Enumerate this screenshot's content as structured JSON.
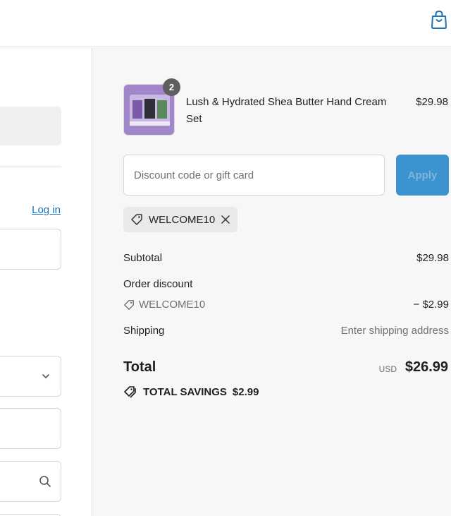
{
  "header": {
    "cart_icon": "shopping-bag-icon"
  },
  "left": {
    "login_label": "Log in"
  },
  "product": {
    "name": "Lush & Hydrated Shea Butter Hand Cream Set",
    "price": "$29.98",
    "quantity": "2"
  },
  "discount": {
    "placeholder": "Discount code or gift card",
    "apply_label": "Apply",
    "applied_code": "WELCOME10"
  },
  "summary": {
    "subtotal_label": "Subtotal",
    "subtotal_value": "$29.98",
    "order_discount_label": "Order discount",
    "discount_code": "WELCOME10",
    "discount_value": "− $2.99",
    "shipping_label": "Shipping",
    "shipping_value": "Enter shipping address",
    "total_label": "Total",
    "currency": "USD",
    "total_value": "$26.99",
    "savings_label": "TOTAL SAVINGS",
    "savings_value": "$2.99"
  },
  "colors": {
    "accent": "#3d93d0",
    "link": "#1f73b7",
    "panel_bg": "#f7f7f7"
  }
}
